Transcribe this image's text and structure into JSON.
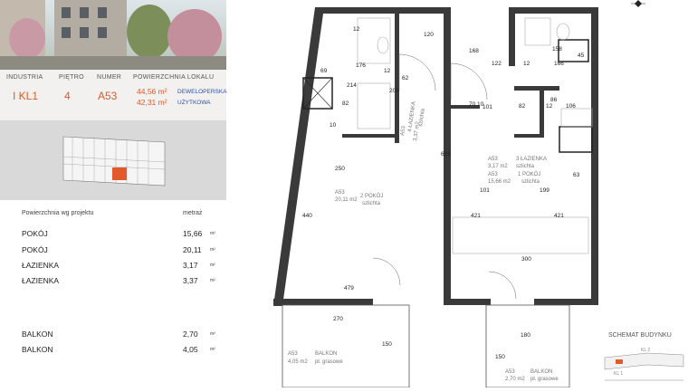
{
  "header_labels": {
    "industria": "INDUSTRIA",
    "pietro": "PIĘTRO",
    "numer": "NUMER",
    "powierzchnia": "POWIERZCHNIA LOKALU"
  },
  "header_values": {
    "industria": "I KL1",
    "pietro": "4",
    "numer": "A53",
    "area_deweloperska": "44,56 m²",
    "area_deweloperska_label": "DEWELOPERSKA",
    "area_uzytkowa": "42,31 m²",
    "area_uzytkowa_label": "UŻYTKOWA"
  },
  "table": {
    "heading": "Powierzchnia wg projektu",
    "unit_heading": "metraż",
    "unit": "m²",
    "rows": [
      {
        "label": "POKÓJ",
        "value": "15,66"
      },
      {
        "label": "POKÓJ",
        "value": "20,11"
      },
      {
        "label": "ŁAZIENKA",
        "value": "3,17"
      },
      {
        "label": "ŁAZIENKA",
        "value": "3,37"
      }
    ],
    "balconies": [
      {
        "label": "BALKON",
        "value": "2,70"
      },
      {
        "label": "BALKON",
        "value": "4,05"
      }
    ]
  },
  "plan": {
    "dims": {
      "d12a": "12",
      "d120": "120",
      "d69": "69",
      "d176": "176",
      "d12b": "12",
      "d214": "214",
      "d62": "62",
      "d82a": "82",
      "d206": "206",
      "d168": "168",
      "d122": "122",
      "d12c": "12",
      "d158": "158",
      "d166": "166",
      "d45": "45",
      "d7010": "70 10",
      "d101a": "101",
      "d82b": "82",
      "d12d": "12",
      "d86": "86",
      "d106": "106",
      "d10a": "10",
      "d639": "639",
      "d250": "250",
      "d440": "440",
      "d101b": "101",
      "d199": "199",
      "d63": "63",
      "d421a": "421",
      "d421b": "421",
      "d300": "300",
      "d479": "479",
      "d270": "270",
      "d150a": "150",
      "d180": "180",
      "d150b": "150"
    },
    "rooms": {
      "bath1_code": "A53",
      "bath1_name": "4 ŁAZIENKA",
      "bath1_area": "3,37 m2",
      "bath1_floor": "szlichta",
      "bath2_code": "A53",
      "bath2_name": "3 ŁAZIENKA",
      "bath2_area": "3,17 m2",
      "bath2_floor": "szlichta",
      "room1_code": "A53",
      "room1_name": "1 POKÓJ",
      "room1_area": "15,66 m2",
      "room1_floor": "szlichta",
      "room2_code": "A53",
      "room2_name": "2 POKÓJ",
      "room2_area": "20,11 m2",
      "room2_floor": "szlichta",
      "balc1_code": "A53",
      "balc1_name": "BALKON",
      "balc1_area": "4,05 m2",
      "balc1_floor": "pł. grasowe",
      "balc2_code": "A53",
      "balc2_name": "BALKON",
      "balc2_area": "2,70 m2",
      "balc2_floor": "pł. grasowe"
    },
    "schema_title": "SCHEMAT BUDYNKU",
    "schema_labels": {
      "a": "KL 2",
      "b": "KL 1"
    }
  },
  "colors": {
    "accent": "#e05a2b",
    "blue": "#2a4fb8",
    "wall": "#3a3a3a",
    "minimap": "#d9d9d9"
  }
}
